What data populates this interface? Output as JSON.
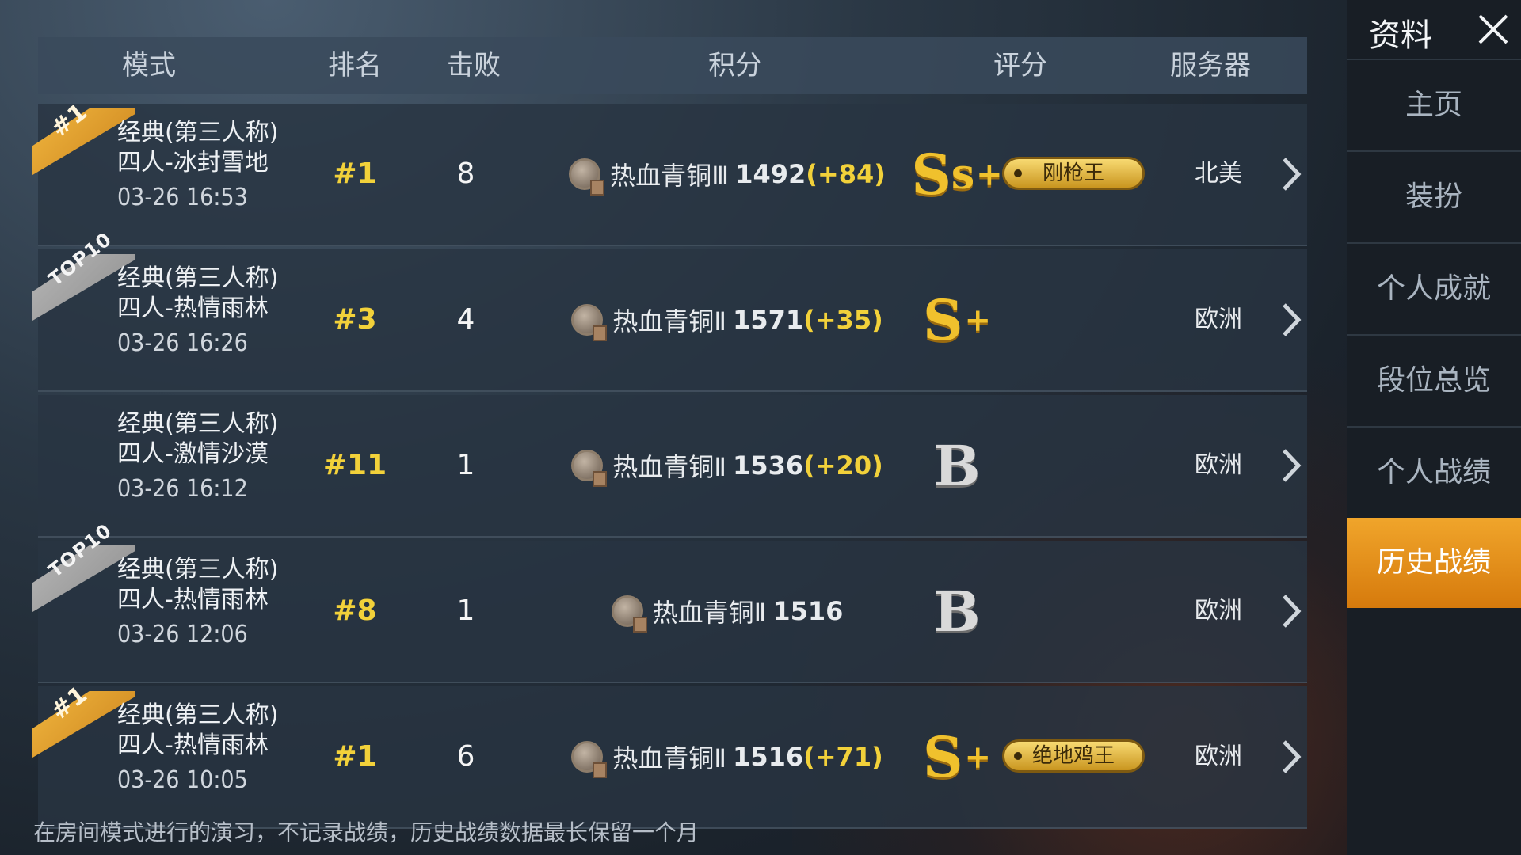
{
  "header": {
    "mode": "模式",
    "rank": "排名",
    "kills": "击败",
    "score": "积分",
    "rating": "评分",
    "server": "服务器"
  },
  "rows": [
    {
      "ribbon": "#1",
      "ribbon_color": "#e8a531",
      "mode_line1": "经典(第三人称)",
      "mode_line2": "四人-冰封雪地",
      "time": "03-26 16:53",
      "rank": "#1",
      "kills": "8",
      "tier": "热血青铜Ⅲ",
      "points": "1492",
      "delta": "(+84)",
      "grade": "S",
      "grade_sub": "s",
      "grade_plus": "+",
      "title_badge": "刚枪王",
      "server": "北美"
    },
    {
      "ribbon": "TOP10",
      "ribbon_color": "#a9a9a9",
      "mode_line1": "经典(第三人称)",
      "mode_line2": "四人-热情雨林",
      "time": "03-26 16:26",
      "rank": "#3",
      "kills": "4",
      "tier": "热血青铜Ⅱ",
      "points": "1571",
      "delta": "(+35)",
      "grade": "S",
      "grade_sub": "",
      "grade_plus": "+",
      "title_badge": "",
      "server": "欧洲"
    },
    {
      "ribbon": "",
      "ribbon_color": "",
      "mode_line1": "经典(第三人称)",
      "mode_line2": "四人-激情沙漠",
      "time": "03-26 16:12",
      "rank": "#11",
      "kills": "1",
      "tier": "热血青铜Ⅱ",
      "points": "1536",
      "delta": "(+20)",
      "grade": "B",
      "grade_sub": "",
      "grade_plus": "",
      "title_badge": "",
      "server": "欧洲"
    },
    {
      "ribbon": "TOP10",
      "ribbon_color": "#a9a9a9",
      "mode_line1": "经典(第三人称)",
      "mode_line2": "四人-热情雨林",
      "time": "03-26 12:06",
      "rank": "#8",
      "kills": "1",
      "tier": "热血青铜Ⅱ",
      "points": "1516",
      "delta": "",
      "grade": "B",
      "grade_sub": "",
      "grade_plus": "",
      "title_badge": "",
      "server": "欧洲"
    },
    {
      "ribbon": "#1",
      "ribbon_color": "#e8a531",
      "mode_line1": "经典(第三人称)",
      "mode_line2": "四人-热情雨林",
      "time": "03-26 10:05",
      "rank": "#1",
      "kills": "6",
      "tier": "热血青铜Ⅱ",
      "points": "1516",
      "delta": "(+71)",
      "grade": "S",
      "grade_sub": "",
      "grade_plus": "+",
      "title_badge": "绝地鸡王",
      "server": "欧洲"
    }
  ],
  "footer_note": "在房间模式进行的演习，不记录战绩，历史战绩数据最长保留一个月",
  "sidebar": {
    "title": "资料",
    "items": [
      {
        "label": "主页",
        "active": false
      },
      {
        "label": "装扮",
        "active": false
      },
      {
        "label": "个人成就",
        "active": false
      },
      {
        "label": "段位总览",
        "active": false
      },
      {
        "label": "个人战绩",
        "active": false
      },
      {
        "label": "历史战绩",
        "active": true
      }
    ]
  },
  "colors": {
    "accent": "#e8921f",
    "gold_text": "#f2d13a"
  },
  "icons": {
    "close": "close-icon",
    "row_arrow": "chevron-right-icon",
    "tier_medal": "bronze-medal-icon"
  }
}
